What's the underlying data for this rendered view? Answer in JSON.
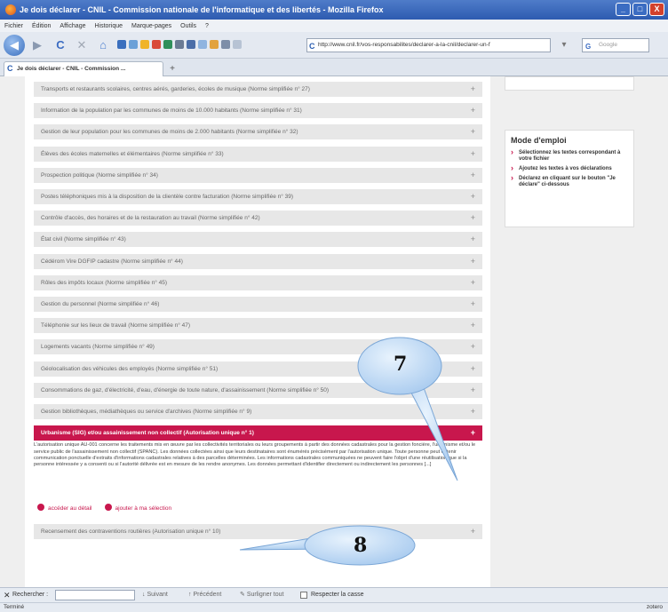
{
  "window": {
    "title": "Je dois déclarer - CNIL - Commission nationale de l'informatique et des libertés - Mozilla Firefox",
    "controls": [
      "_",
      "□",
      "X"
    ]
  },
  "menu": [
    "Fichier",
    "Édition",
    "Affichage",
    "Historique",
    "Marque-pages",
    "Outils",
    "?"
  ],
  "nav": {
    "url": "http://www.cnil.fr/vos-responsabilites/declarer-a-la-cnil/declarer-un-f",
    "search_placeholder": "Google"
  },
  "tab": {
    "label": "Je dois déclarer - CNIL - Commission ...",
    "new_tab": "+"
  },
  "accordion": [
    {
      "label": "Transports et restaurants scolaires, centres aérés, garderies, écoles de musique (Norme simplifiée n° 27)",
      "active": false
    },
    {
      "label": "Information de la population par les communes de moins de 10.000 habitants (Norme simplifiée n° 31)",
      "active": false
    },
    {
      "label": "Gestion de leur population pour les communes de moins de 2.000 habitants (Norme simplifiée n° 32)",
      "active": false
    },
    {
      "label": "Élèves des écoles maternelles et élémentaires (Norme simplifiée n° 33)",
      "active": false
    },
    {
      "label": "Prospection politique (Norme simplifiée n° 34)",
      "active": false
    },
    {
      "label": "Postes téléphoniques mis à la disposition de la clientèle contre facturation (Norme simplifiée n° 39)",
      "active": false
    },
    {
      "label": "Contrôle d'accès, des horaires et de la restauration au travail (Norme simplifiée n° 42)",
      "active": false
    },
    {
      "label": "État civil (Norme simplifiée n° 43)",
      "active": false
    },
    {
      "label": "Cédérom Vire DGFIP cadastre (Norme simplifiée n° 44)",
      "active": false
    },
    {
      "label": "Rôles des impôts locaux (Norme simplifiée n° 45)",
      "active": false
    },
    {
      "label": "Gestion du personnel (Norme simplifiée n° 46)",
      "active": false
    },
    {
      "label": "Téléphonie sur les lieux de travail (Norme simplifiée n° 47)",
      "active": false
    },
    {
      "label": "Logements vacants (Norme simplifiée n° 49)",
      "active": false
    },
    {
      "label": "Géolocalisation des véhicules des employés (Norme simplifiée n° 51)",
      "active": false
    },
    {
      "label": "Consommations de gaz, d'électricité, d'eau, d'énergie de toute nature, d'assainissement (Norme simplifiée n° 50)",
      "active": false
    },
    {
      "label": "Gestion bibliothèques, médiathèques ou service d'archives (Norme simplifiée n° 9)",
      "active": false
    },
    {
      "label": "Urbanisme (SIG) et/ou assainissement non collectif (Autorisation unique n° 1)",
      "active": true
    },
    {
      "label": "Recensement des contraventions routières (Autorisation unique n° 10)",
      "active": false
    }
  ],
  "plus_sign": "+",
  "description": "L'autorisation unique AU-001 concerne les traitements mis en œuvre par les collectivités territoriales ou leurs groupements à partir des données cadastrales pour la gestion foncière, l'urbanisme et/ou le service public de l'assainissement non collectif (SPANC). Les données collectées ainsi que leurs destinataires sont énumérés précisément par l'autorisation unique. Toute personne peut obtenir communication ponctuelle d'extraits d'informations cadastrales relatives à des parcelles déterminées. Les informations cadastrales communiquées ne peuvent faire l'objet d'une réutilisation que si la personne intéressée y a consenti ou si l'autorité délivrée est en mesure de les rendre anonymes. Les données permettant d'identifier directement ou indirectement les personnes [...]",
  "actions": {
    "details": "accéder au détail",
    "add": "ajouter à ma sélection"
  },
  "sidebar": {
    "title": "Mode d'emploi",
    "steps": [
      "Sélectionnez les textes correspondant à votre fichier",
      "Ajoutez les textes à vos déclarations",
      "Déclarez en cliquant sur le bouton \"Je déclare\" ci-dessous"
    ]
  },
  "callouts": {
    "first": "7",
    "second": "8"
  },
  "findbar": {
    "close": "✕",
    "label": "Rechercher :",
    "next": "Suivant",
    "previous": "Précédent",
    "highlight": "Surligner tout",
    "match_case": "Respecter la casse"
  },
  "status": {
    "left": "Terminé",
    "right": "zotero"
  }
}
